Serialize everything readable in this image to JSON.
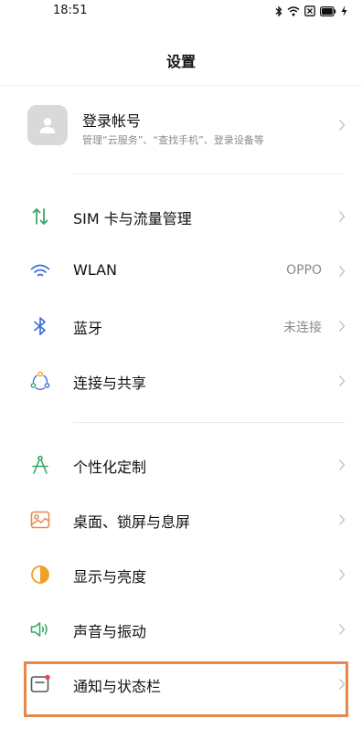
{
  "status_bar": {
    "time": "18:51",
    "icons": [
      "bluetooth-icon",
      "wifi-icon",
      "screen-record-icon",
      "battery-icon",
      "charging-icon"
    ]
  },
  "header": {
    "title": "设置"
  },
  "account": {
    "name": "登录帐号",
    "subtitle": "管理“云服务”、“查找手机”、登录设备等"
  },
  "settings": {
    "sim": {
      "label": "SIM 卡与流量管理",
      "icon": "sim-data-icon",
      "color": "#3aa86b"
    },
    "wlan": {
      "label": "WLAN",
      "value": "OPPO",
      "icon": "wifi-icon",
      "color": "#3b6fd8"
    },
    "bluetooth": {
      "label": "蓝牙",
      "value": "未连接",
      "icon": "bluetooth-icon",
      "color": "#3b6fd8"
    },
    "connection": {
      "label": "连接与共享",
      "icon": "connection-share-icon",
      "color": "#f0a02a"
    },
    "personalization": {
      "label": "个性化定制",
      "icon": "compass-icon",
      "color": "#3aa86b"
    },
    "desktop": {
      "label": "桌面、锁屏与息屏",
      "icon": "wallpaper-icon",
      "color": "#e9894a"
    },
    "display": {
      "label": "显示与亮度",
      "icon": "brightness-icon",
      "color": "#f0a02a"
    },
    "sound": {
      "label": "声音与振动",
      "icon": "sound-icon",
      "color": "#3aa86b"
    },
    "notification": {
      "label": "通知与状态栏",
      "icon": "notification-icon",
      "color": "#e84c4c"
    }
  },
  "highlight_color": "#e98748"
}
